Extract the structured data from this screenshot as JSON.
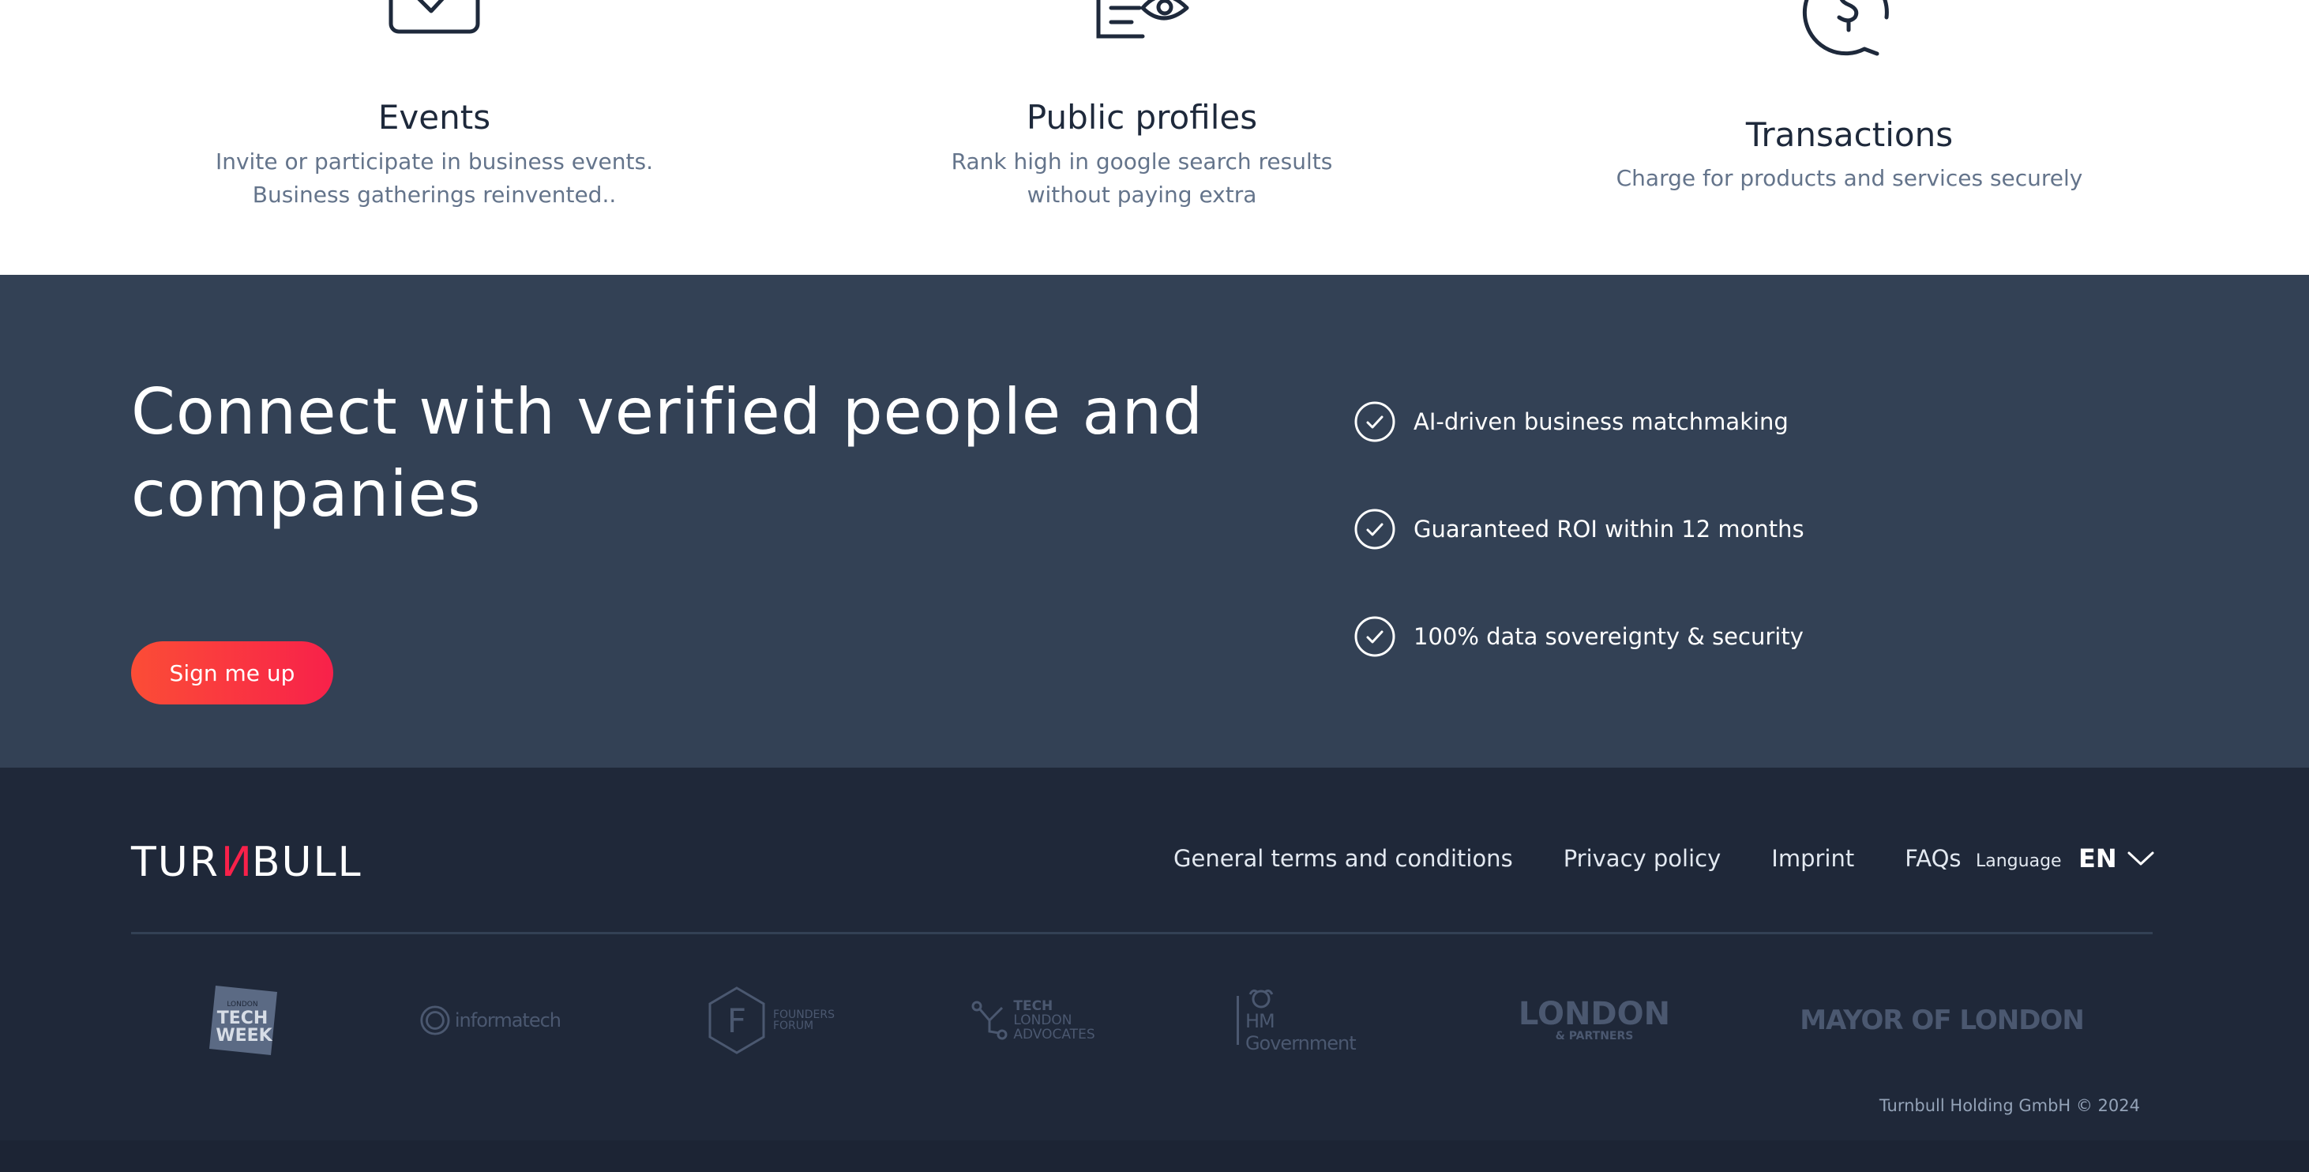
{
  "features": [
    {
      "icon": "calendar-check-icon",
      "title": "Events",
      "lines": [
        "Invite or participate in business events.",
        "Business gatherings reinvented.."
      ]
    },
    {
      "icon": "profile-eye-icon",
      "title": "Public profiles",
      "lines": [
        "Rank high in google search results",
        "without paying extra"
      ]
    },
    {
      "icon": "dollar-circle-icon",
      "title": "Transactions",
      "lines": [
        "Charge for products and services securely"
      ]
    }
  ],
  "cta": {
    "heading": "Connect with verified people and companies",
    "button_label": "Sign me up",
    "benefits": [
      {
        "icon": "check-circle-icon",
        "text": "AI-driven business matchmaking"
      },
      {
        "icon": "check-circle-icon",
        "text": "Guaranteed ROI within 12 months"
      },
      {
        "icon": "check-circle-icon",
        "text": "100% data sovereignty & security"
      }
    ]
  },
  "footer": {
    "logo": {
      "part1": "TUR",
      "part2": "N",
      "part3": "BULL"
    },
    "links": [
      "General terms and conditions",
      "Privacy policy",
      "Imprint",
      "FAQs"
    ],
    "language_label": "Language",
    "language_value": "EN",
    "partners": [
      {
        "name": "London Tech Week",
        "lines": [
          "LONDON",
          "TECH",
          "WEEK"
        ]
      },
      {
        "name": "Informa Tech",
        "text": "informatech"
      },
      {
        "name": "Founders Forum",
        "letter": "F",
        "lines": [
          "FOUNDERS",
          "FORUM"
        ]
      },
      {
        "name": "Tech London Advocates",
        "lines": [
          "TECH",
          "LONDON",
          "ADVOCATES"
        ]
      },
      {
        "name": "HM Government",
        "text": "HM Government"
      },
      {
        "name": "London & Partners",
        "lines": [
          "LONDON",
          "& PARTNERS"
        ]
      },
      {
        "name": "Mayor of London",
        "text": "MAYOR OF LONDON"
      }
    ],
    "copyright": "Turnbull Holding GmbH © 2024"
  },
  "colors": {
    "cta_bg": "#334155",
    "footer_bg": "#1f2839",
    "accent_gradient_start": "#fb4d36",
    "accent_gradient_end": "#f8214a",
    "partner_logo": "#4b5870"
  }
}
